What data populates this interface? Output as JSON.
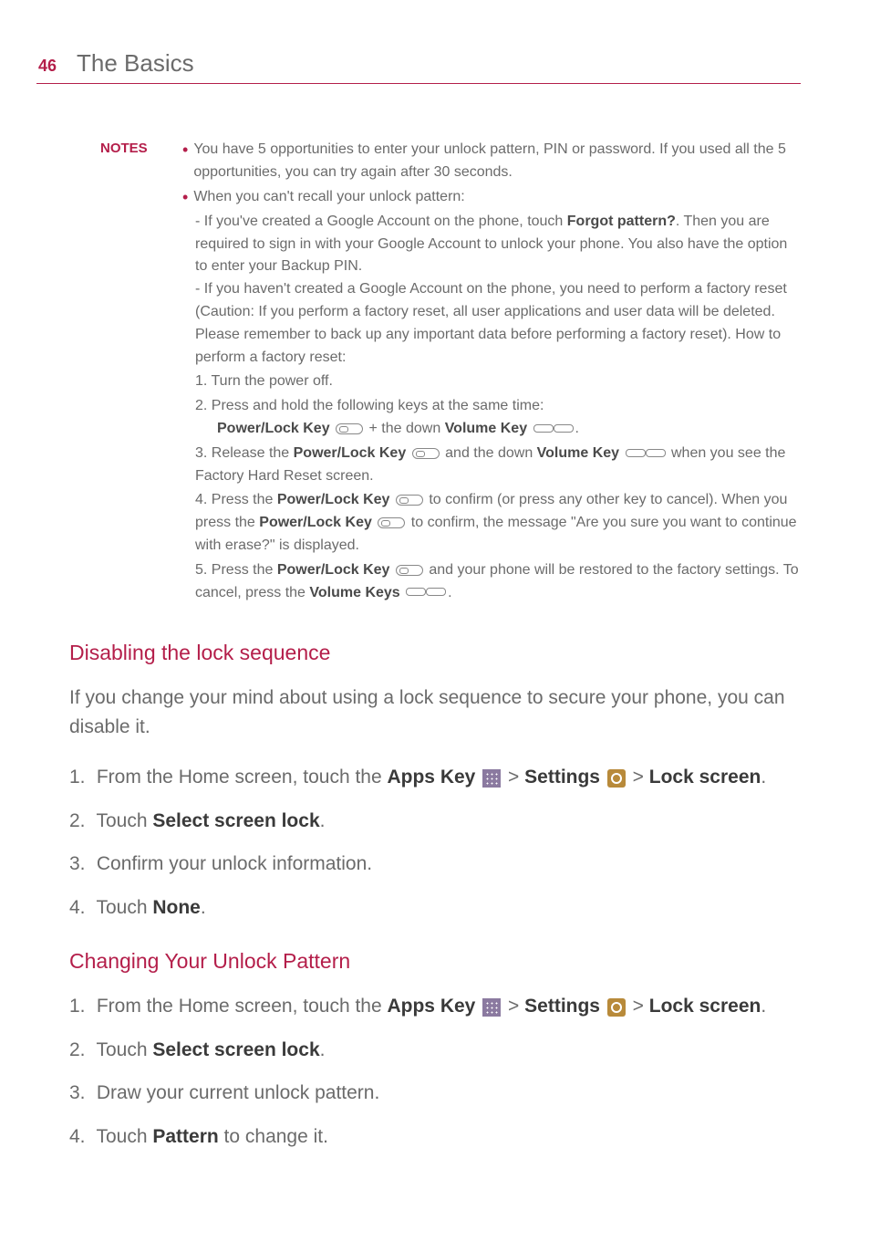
{
  "page": {
    "number": "46",
    "title": "The Basics"
  },
  "notes": {
    "label": "NOTES",
    "b1": "You have 5 opportunities to enter your unlock pattern, PIN or password. If you used all the 5 opportunities, you can try again after 30 seconds.",
    "b2": "When you can't recall your unlock pattern:",
    "b2_sub1a": "- If you've created a Google Account on the phone, touch ",
    "b2_sub1_bold": "Forgot pattern?",
    "b2_sub1b": ". Then you are required to sign in with your Google Account to unlock your phone. You also have the option to enter your Backup PIN.",
    "b2_sub2": "- If you haven't created a Google Account on the phone, you need to perform a factory reset (Caution: If you perform a factory reset, all user applications and user data will be deleted. Please remember to back up any important data before performing a factory reset). How to perform a factory reset:",
    "n1": "1. Turn the power off.",
    "n2": "2. Press and hold the following keys at the same time:",
    "n2_pk": "Power/Lock Key",
    "n2_plus": " + the down ",
    "n2_vk": "Volume Key",
    "n2_dot": ".",
    "n3a": "3. Release the ",
    "n3_pk": "Power/Lock Key",
    "n3b": " and the down ",
    "n3_vk": "Volume Key",
    "n3c": " when you see the Factory Hard Reset screen.",
    "n4a": "4. Press the ",
    "n4_pk": "Power/Lock Key",
    "n4b": " to confirm (or press any other key to cancel). When you press the ",
    "n4_pk2": "Power/Lock Key",
    "n4c": " to confirm, the message \"Are you sure you want to continue with erase?\" is displayed.",
    "n5a": "5. Press the ",
    "n5_pk": "Power/Lock Key",
    "n5b": " and your phone will be restored to the factory settings. To cancel, press the ",
    "n5_vk": "Volume Keys",
    "n5c": "."
  },
  "section1": {
    "heading": "Disabling the lock sequence",
    "intro": "If you change your mind about using a lock sequence to secure your phone, you can disable it.",
    "s1a": "From the Home screen, touch the ",
    "s1_apps": "Apps Key",
    "s1b": " > ",
    "s1_settings": "Settings",
    "s1c": " > ",
    "s1_lock": "Lock screen",
    "s1d": ".",
    "s2a": "Touch ",
    "s2_ssl": "Select screen lock",
    "s2b": ".",
    "s3": "Confirm your unlock information.",
    "s4a": "Touch ",
    "s4_none": "None",
    "s4b": "."
  },
  "section2": {
    "heading": "Changing Your Unlock Pattern",
    "s1a": "From the Home screen, touch the ",
    "s1_apps": "Apps Key",
    "s1b": " > ",
    "s1_settings": "Settings",
    "s1c": " > ",
    "s1_lock": "Lock screen",
    "s1d": ".",
    "s2a": "Touch ",
    "s2_ssl": "Select screen lock",
    "s2b": ".",
    "s3": "Draw your current unlock pattern.",
    "s4a": "Touch ",
    "s4_pat": "Pattern",
    "s4b": " to change it."
  },
  "nums": {
    "n1": "1.",
    "n2": "2.",
    "n3": "3.",
    "n4": "4."
  }
}
